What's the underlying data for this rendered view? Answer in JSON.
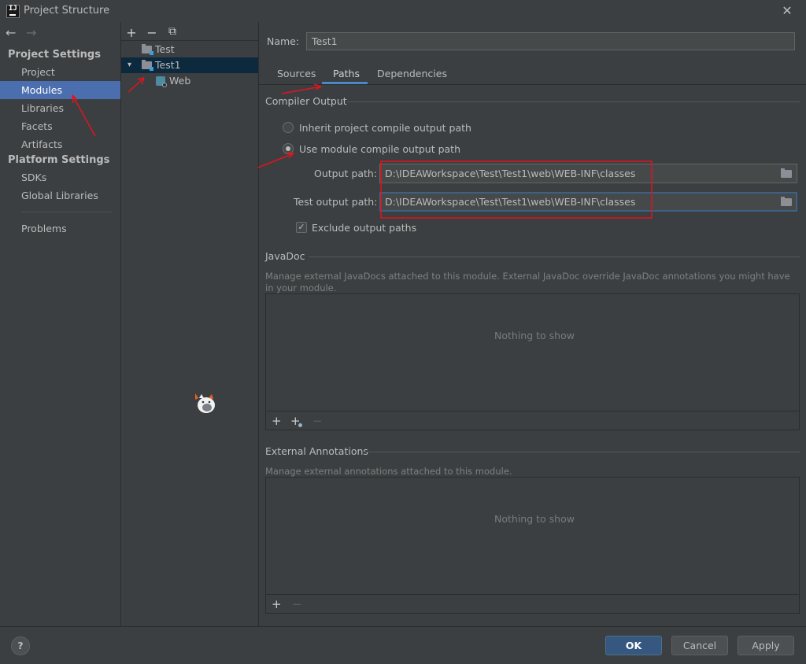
{
  "window": {
    "title": "Project Structure",
    "close_glyph": "✕"
  },
  "nav": {
    "back_glyph": "←",
    "forward_glyph": "→",
    "project_settings_header": "Project Settings",
    "platform_settings_header": "Platform Settings",
    "items": [
      "Project",
      "Modules",
      "Libraries",
      "Facets",
      "Artifacts"
    ],
    "platform_items": [
      "SDKs",
      "Global Libraries"
    ],
    "problems": "Problems",
    "active": "Modules"
  },
  "modules_toolbar": {
    "add": "+",
    "remove": "−",
    "copy": "⧉"
  },
  "module_tree": {
    "items": [
      {
        "label": "Test",
        "level": 0,
        "expanded": false,
        "type": "module"
      },
      {
        "label": "Test1",
        "level": 0,
        "expanded": true,
        "type": "module",
        "selected": true
      },
      {
        "label": "Web",
        "level": 1,
        "type": "web-facet"
      }
    ]
  },
  "module": {
    "name_label": "Name:",
    "name_value": "Test1",
    "tabs": [
      "Sources",
      "Paths",
      "Dependencies"
    ],
    "active_tab": "Paths"
  },
  "compiler_output": {
    "title": "Compiler Output",
    "inherit_label": "Inherit project compile output path",
    "use_module_label": "Use module compile output path",
    "selected": "use_module",
    "output_path_label": "Output path:",
    "output_path_value": "D:\\IDEAWorkspace\\Test\\Test1\\web\\WEB-INF\\classes",
    "test_output_path_label": "Test output path:",
    "test_output_path_value": "D:\\IDEAWorkspace\\Test\\Test1\\web\\WEB-INF\\classes",
    "exclude_label": "Exclude output paths",
    "exclude_checked": true
  },
  "javadoc": {
    "title": "JavaDoc",
    "description": "Manage external JavaDocs attached to this module. External JavaDoc override JavaDoc annotations you might have in your module.",
    "empty_text": "Nothing to show",
    "toolbar": {
      "add": "+",
      "add_url": "+",
      "remove": "−"
    }
  },
  "external_annotations": {
    "title": "External Annotations",
    "description": "Manage external annotations attached to this module.",
    "empty_text": "Nothing to show",
    "toolbar": {
      "add": "+",
      "remove": "−"
    }
  },
  "footer": {
    "help": "?",
    "ok": "OK",
    "cancel": "Cancel",
    "apply": "Apply"
  },
  "colors": {
    "accent": "#4b6eaf",
    "annotation_red": "#e0141e",
    "tab_underline": "#4a88c7"
  }
}
